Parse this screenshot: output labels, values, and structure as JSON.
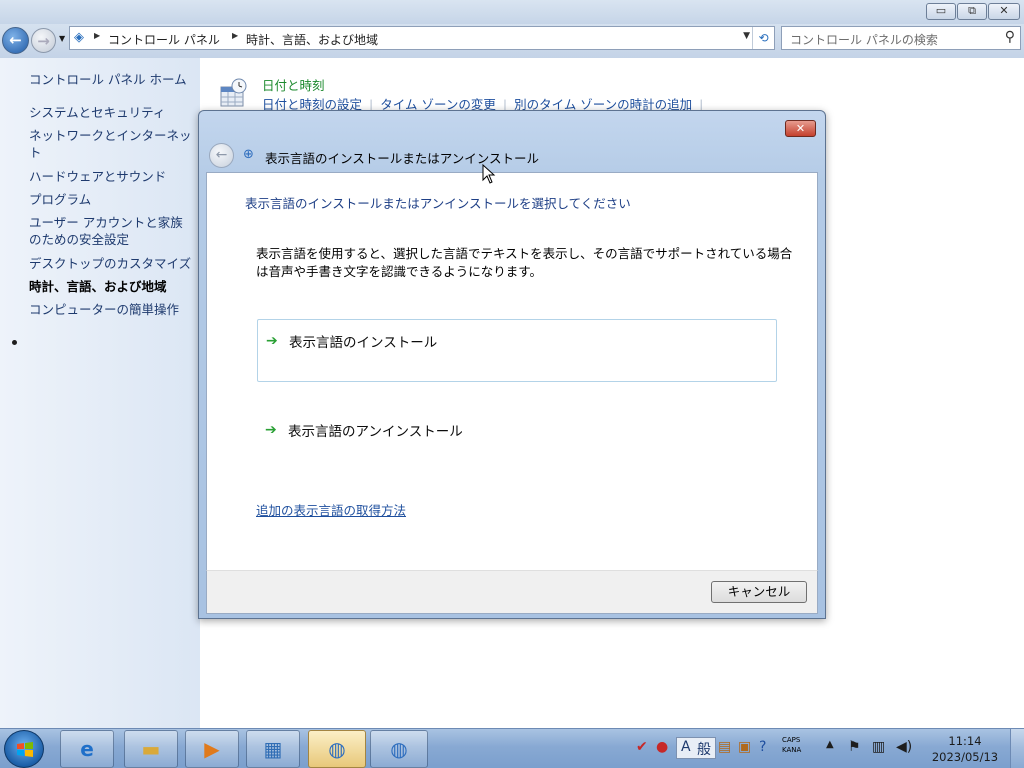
{
  "window": {
    "caption_buttons": {
      "minimize": "▭",
      "maximize": "⧉",
      "close": "✕"
    }
  },
  "navbar": {
    "back_icon": "back-arrow-icon",
    "forward_icon": "forward-arrow-icon",
    "breadcrumb": [
      "コントロール パネル",
      "時計、言語、および地域"
    ],
    "search_placeholder": "コントロール パネルの検索"
  },
  "sidebar": {
    "home": "コントロール パネル ホーム",
    "items": [
      "システムとセキュリティ",
      "ネットワークとインターネット",
      "ハードウェアとサウンド",
      "プログラム",
      "ユーザー アカウントと家族のための安全設定",
      "デスクトップのカスタマイズ",
      "時計、言語、および地域",
      "コンピューターの簡単操作"
    ],
    "active_index": 6
  },
  "main": {
    "category_title": "日付と時刻",
    "links": [
      "日付と時刻の設定",
      "タイム ゾーンの変更",
      "別のタイム ゾーンの時計の追加"
    ]
  },
  "dialog": {
    "title": "表示言語のインストールまたはアンインストール",
    "heading": "表示言語のインストールまたはアンインストールを選択してください",
    "description": "表示言語を使用すると、選択した言語でテキストを表示し、その言語でサポートされている場合は音声や手書き文字を認識できるようになります。",
    "options": [
      "表示言語のインストール",
      "表示言語のアンインストール"
    ],
    "more_link": "追加の表示言語の取得方法",
    "cancel": "キャンセル"
  },
  "taskbar": {
    "apps": [
      "internet-explorer-icon",
      "explorer-folder-icon",
      "media-player-icon",
      "control-panel-icon",
      "region-language-icon",
      "language-install-icon"
    ],
    "ime_mode": "A",
    "ime_label": "般",
    "caps": "CAPS",
    "kana": "KANA",
    "time": "11:14",
    "date": "2023/05/13"
  }
}
